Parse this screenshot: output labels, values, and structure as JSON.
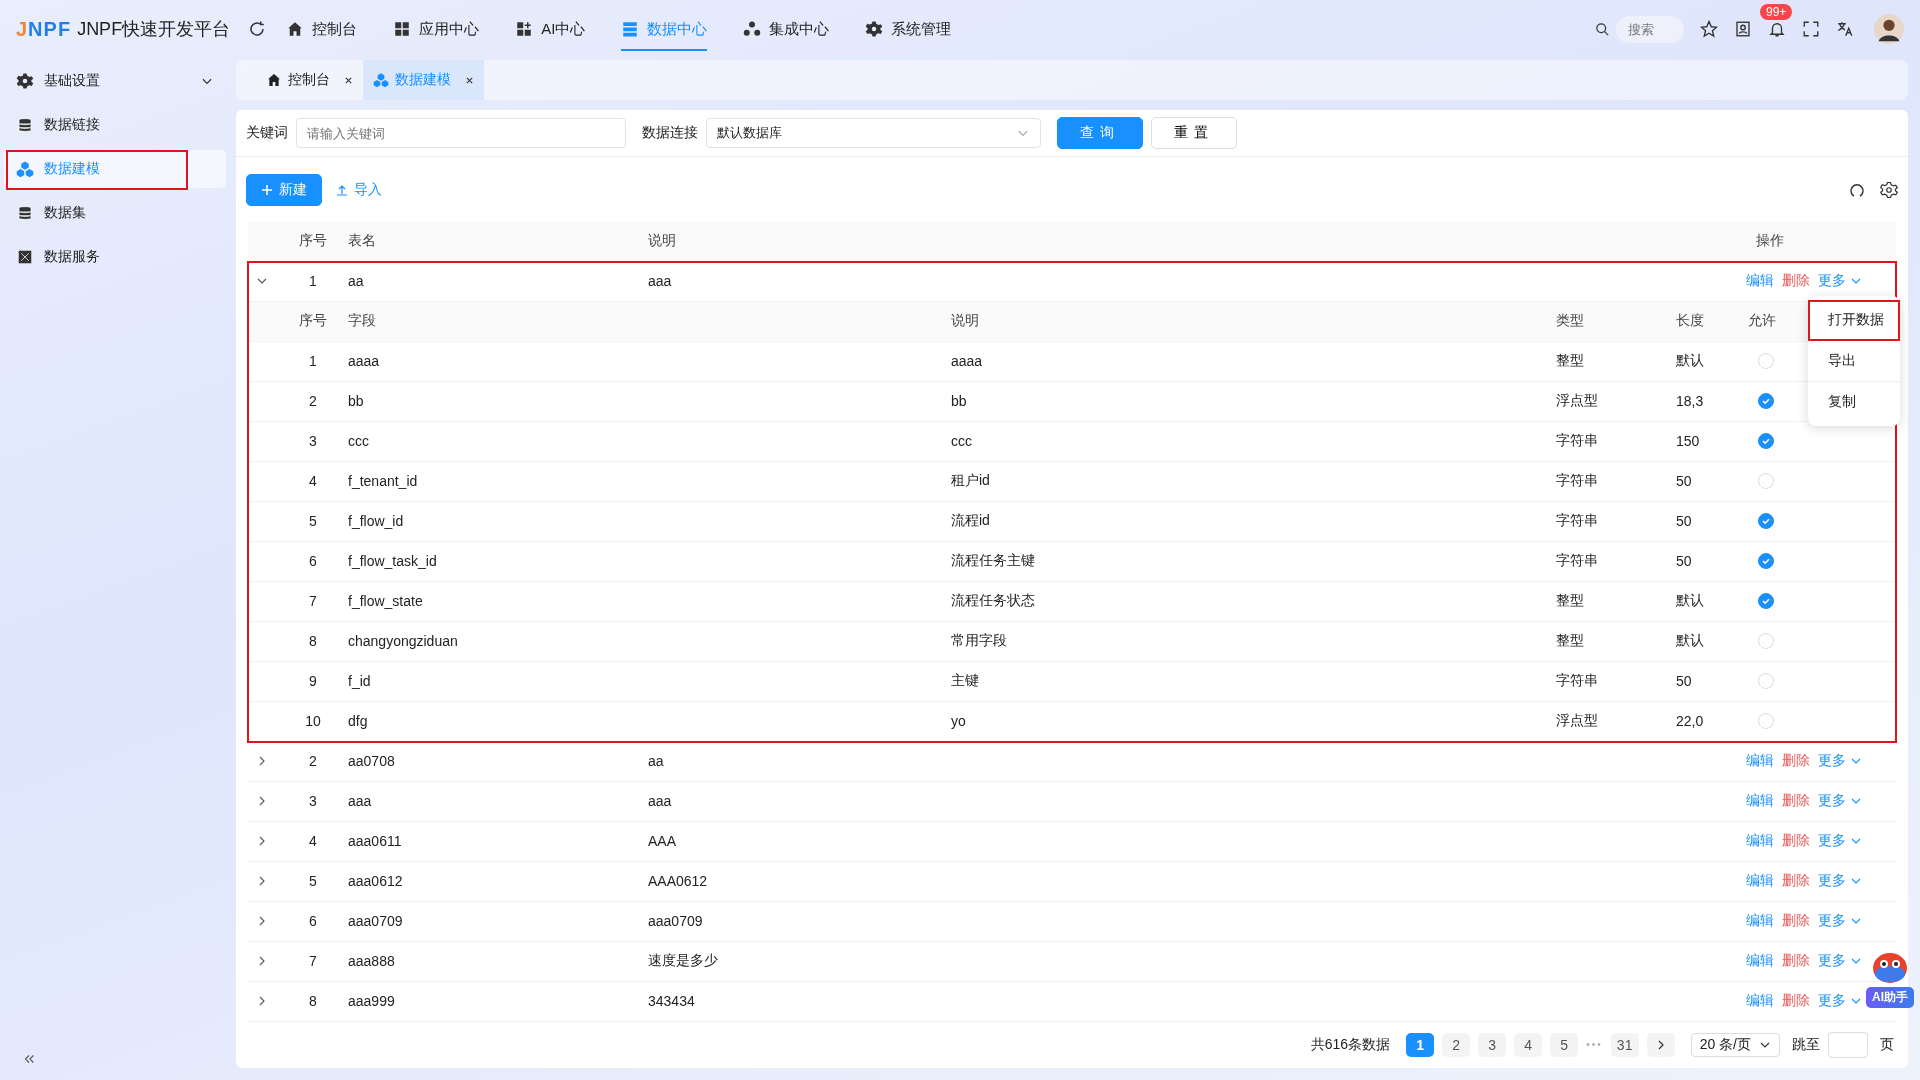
{
  "header": {
    "logo": "JNPF",
    "title": "JNPF快速开发平台",
    "nav": [
      {
        "label": "控制台",
        "selected": false
      },
      {
        "label": "应用中心",
        "selected": false
      },
      {
        "label": "AI中心",
        "selected": false
      },
      {
        "label": "数据中心",
        "selected": true
      },
      {
        "label": "集成中心",
        "selected": false
      },
      {
        "label": "系统管理",
        "selected": false
      }
    ],
    "search": {
      "placeholder": "搜索"
    },
    "badge": "99+"
  },
  "sidebar": {
    "items": [
      {
        "label": "基础设置",
        "expandable": true,
        "selected": false,
        "annotated": false
      },
      {
        "label": "数据链接",
        "expandable": false,
        "selected": false,
        "annotated": false
      },
      {
        "label": "数据建模",
        "expandable": false,
        "selected": true,
        "annotated": true
      },
      {
        "label": "数据集",
        "expandable": false,
        "selected": false,
        "annotated": false
      },
      {
        "label": "数据服务",
        "expandable": false,
        "selected": false,
        "annotated": false
      }
    ]
  },
  "tabs": [
    {
      "label": "控制台",
      "selected": false
    },
    {
      "label": "数据建模",
      "selected": true
    }
  ],
  "filters": {
    "keyword_label": "关键词",
    "keyword_placeholder": "请输入关键词",
    "connection_label": "数据连接",
    "connection_value": "默认数据库",
    "query": "查询",
    "reset": "重置"
  },
  "toolbar": {
    "new": "新建",
    "import": "导入"
  },
  "table": {
    "columns": [
      "序号",
      "表名",
      "说明",
      "操作"
    ],
    "field_columns": [
      "序号",
      "字段",
      "说明",
      "类型",
      "长度",
      "允许"
    ],
    "rows": [
      {
        "seq": "1",
        "name": "aa",
        "desc": "aaa",
        "expanded": true,
        "annotated": true,
        "edit": "编辑",
        "delete": "删除",
        "more": "更多",
        "fields": [
          {
            "seq": "1",
            "field": "aaaa",
            "desc": "aaaa",
            "type": "整型",
            "length": "默认",
            "nullable": false
          },
          {
            "seq": "2",
            "field": "bb",
            "desc": "bb",
            "type": "浮点型",
            "length": "18,3",
            "nullable": true
          },
          {
            "seq": "3",
            "field": "ccc",
            "desc": "ccc",
            "type": "字符串",
            "length": "150",
            "nullable": true
          },
          {
            "seq": "4",
            "field": "f_tenant_id",
            "desc": "租户id",
            "type": "字符串",
            "length": "50",
            "nullable": false
          },
          {
            "seq": "5",
            "field": "f_flow_id",
            "desc": "流程id",
            "type": "字符串",
            "length": "50",
            "nullable": true
          },
          {
            "seq": "6",
            "field": "f_flow_task_id",
            "desc": "流程任务主键",
            "type": "字符串",
            "length": "50",
            "nullable": true
          },
          {
            "seq": "7",
            "field": "f_flow_state",
            "desc": "流程任务状态",
            "type": "整型",
            "length": "默认",
            "nullable": true
          },
          {
            "seq": "8",
            "field": "changyongziduan",
            "desc": "常用字段",
            "type": "整型",
            "length": "默认",
            "nullable": false
          },
          {
            "seq": "9",
            "field": "f_id",
            "desc": "主键",
            "type": "字符串",
            "length": "50",
            "nullable": false
          },
          {
            "seq": "10",
            "field": "dfg",
            "desc": "yo",
            "type": "浮点型",
            "length": "22,0",
            "nullable": false
          }
        ]
      },
      {
        "seq": "2",
        "name": "aa0708",
        "desc": "aa",
        "expanded": false,
        "annotated": false,
        "edit": "编辑",
        "delete": "删除",
        "more": "更多"
      },
      {
        "seq": "3",
        "name": "aaa",
        "desc": "aaa",
        "expanded": false,
        "annotated": false,
        "edit": "编辑",
        "delete": "删除",
        "more": "更多"
      },
      {
        "seq": "4",
        "name": "aaa0611",
        "desc": "AAA",
        "expanded": false,
        "annotated": false,
        "edit": "编辑",
        "delete": "删除",
        "more": "更多"
      },
      {
        "seq": "5",
        "name": "aaa0612",
        "desc": "AAA0612",
        "expanded": false,
        "annotated": false,
        "edit": "编辑",
        "delete": "删除",
        "more": "更多"
      },
      {
        "seq": "6",
        "name": "aaa0709",
        "desc": "aaa0709",
        "expanded": false,
        "annotated": false,
        "edit": "编辑",
        "delete": "删除",
        "more": "更多"
      },
      {
        "seq": "7",
        "name": "aaa888",
        "desc": "速度是多少",
        "expanded": false,
        "annotated": false,
        "edit": "编辑",
        "delete": "删除",
        "more": "更多"
      },
      {
        "seq": "8",
        "name": "aaa999",
        "desc": "343434",
        "expanded": false,
        "annotated": false,
        "edit": "编辑",
        "delete": "删除",
        "more": "更多"
      }
    ]
  },
  "more_menu": {
    "items": [
      {
        "label": "打开数据",
        "annotated": true
      },
      {
        "label": "导出",
        "annotated": false
      },
      {
        "label": "复制",
        "annotated": false
      }
    ]
  },
  "pagination": {
    "total": "共616条数据",
    "pages": [
      {
        "label": "1",
        "selected": true
      },
      {
        "label": "2",
        "selected": false
      },
      {
        "label": "3",
        "selected": false
      },
      {
        "label": "4",
        "selected": false
      },
      {
        "label": "5",
        "selected": false
      }
    ],
    "ellipsis": "•••",
    "last": "31",
    "page_size": "20 条/页",
    "jump_label": "跳至",
    "jump_suffix": "页"
  },
  "assistant": {
    "label": "AI助手"
  }
}
